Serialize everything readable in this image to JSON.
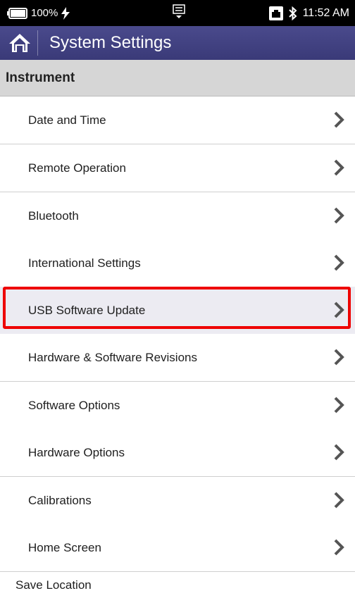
{
  "status_bar": {
    "battery": "100%",
    "time": "11:52 AM"
  },
  "header": {
    "title": "System Settings"
  },
  "section": {
    "title": "Instrument"
  },
  "items": [
    {
      "label": "Date and Time"
    },
    {
      "label": "Remote Operation"
    },
    {
      "label": "Bluetooth"
    },
    {
      "label": "International Settings"
    },
    {
      "label": "USB Software Update"
    },
    {
      "label": "Hardware & Software Revisions"
    },
    {
      "label": "Software Options"
    },
    {
      "label": "Hardware Options"
    },
    {
      "label": "Calibrations"
    },
    {
      "label": "Home Screen"
    }
  ],
  "bottom_item": {
    "label": "Save Location"
  },
  "colors": {
    "title_bar": "#3f3f80",
    "section_bg": "#d6d6d6",
    "highlight": "#ee0000"
  }
}
